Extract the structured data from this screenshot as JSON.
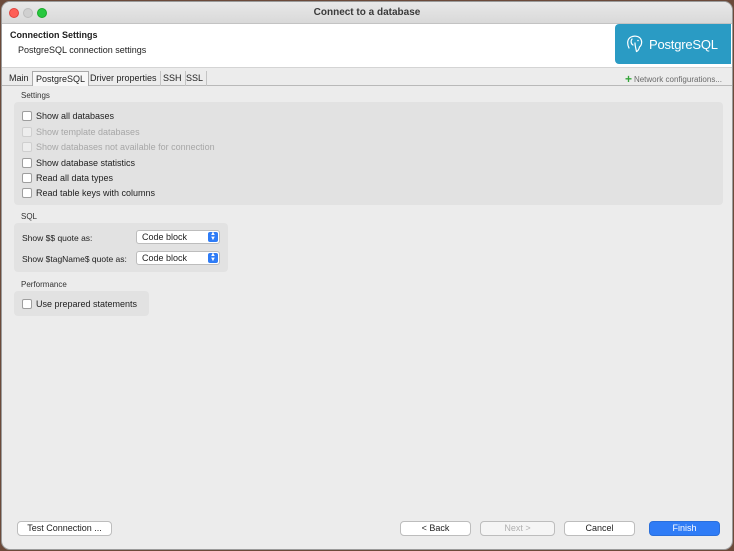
{
  "window": {
    "title": "Connect to a database"
  },
  "header": {
    "title": "Connection Settings",
    "subtitle": "PostgreSQL connection settings",
    "logo_text": "PostgreSQL"
  },
  "tabs": [
    {
      "label": "Main",
      "active": false
    },
    {
      "label": "PostgreSQL",
      "active": true
    },
    {
      "label": "Driver properties",
      "active": false
    },
    {
      "label": "SSH",
      "active": false
    },
    {
      "label": "SSL",
      "active": false
    }
  ],
  "network_config": {
    "label": "Network configurations..."
  },
  "settings": {
    "label": "Settings",
    "options": [
      {
        "label": "Show all databases",
        "checked": false,
        "enabled": true
      },
      {
        "label": "Show template databases",
        "checked": false,
        "enabled": false
      },
      {
        "label": "Show databases not available for connection",
        "checked": false,
        "enabled": false
      },
      {
        "label": "Show database statistics",
        "checked": false,
        "enabled": true
      },
      {
        "label": "Read all data types",
        "checked": false,
        "enabled": true
      },
      {
        "label": "Read table keys with columns",
        "checked": false,
        "enabled": true
      }
    ]
  },
  "sql": {
    "label": "SQL",
    "dollar_quote": {
      "label": "Show $$ quote as:",
      "value": "Code block"
    },
    "tagname_quote": {
      "label": "Show $tagName$ quote as:",
      "value": "Code block"
    }
  },
  "performance": {
    "label": "Performance",
    "prepared": {
      "label": "Use prepared statements",
      "checked": false
    }
  },
  "buttons": {
    "test": "Test Connection ...",
    "back": "< Back",
    "next": "Next >",
    "cancel": "Cancel",
    "finish": "Finish"
  },
  "colors": {
    "accent": "#2f7cf6",
    "logo_bg": "#2a9bc4"
  }
}
